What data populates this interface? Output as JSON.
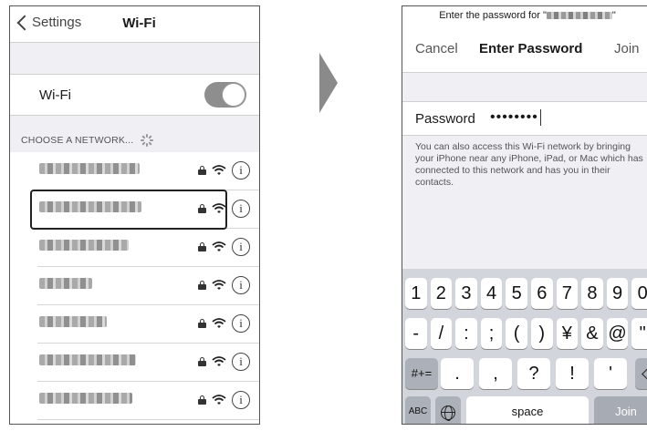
{
  "left_screen": {
    "back_label": "Settings",
    "title": "Wi-Fi",
    "wifi_label": "Wi-Fi",
    "wifi_enabled": true,
    "section_header": "CHOOSE A NETWORK...",
    "networks": [
      {
        "name": "",
        "secured": true
      },
      {
        "name": "",
        "secured": true,
        "selected": true
      },
      {
        "name": "",
        "secured": true
      },
      {
        "name": "",
        "secured": true
      },
      {
        "name": "",
        "secured": true
      },
      {
        "name": "",
        "secured": true
      },
      {
        "name": "",
        "secured": true
      }
    ],
    "info_glyph": "i"
  },
  "right_screen": {
    "prompt_prefix": "Enter the password for \"",
    "prompt_suffix": "\"",
    "cancel_label": "Cancel",
    "title": "Enter Password",
    "join_label": "Join",
    "password_label": "Password",
    "password_value": "••••••••",
    "help_text": "You can also access this Wi-Fi network by bringing your iPhone near any iPhone, iPad, or Mac which has connected to this network and has you in their contacts.",
    "keyboard": {
      "row1": [
        "1",
        "2",
        "3",
        "4",
        "5",
        "6",
        "7",
        "8",
        "9",
        "0"
      ],
      "row2": [
        "-",
        "/",
        ":",
        ";",
        "(",
        ")",
        "¥",
        "&",
        "@",
        "\""
      ],
      "row3_left": "#+=",
      "row3": [
        ".",
        ",",
        "?",
        "!",
        "'"
      ],
      "abc_label": "ABC",
      "space_label": "space",
      "join_key_label": "Join"
    }
  },
  "icons": [
    "chevron-left-icon",
    "spinner-icon",
    "lock-icon",
    "wifi-icon",
    "info-icon",
    "arrow-right-icon",
    "globe-icon",
    "backspace-icon"
  ],
  "colors": {
    "toggle_on": "#8e8e8e",
    "group_background": "#efeff4",
    "keyboard_background": "#d2d5db"
  }
}
